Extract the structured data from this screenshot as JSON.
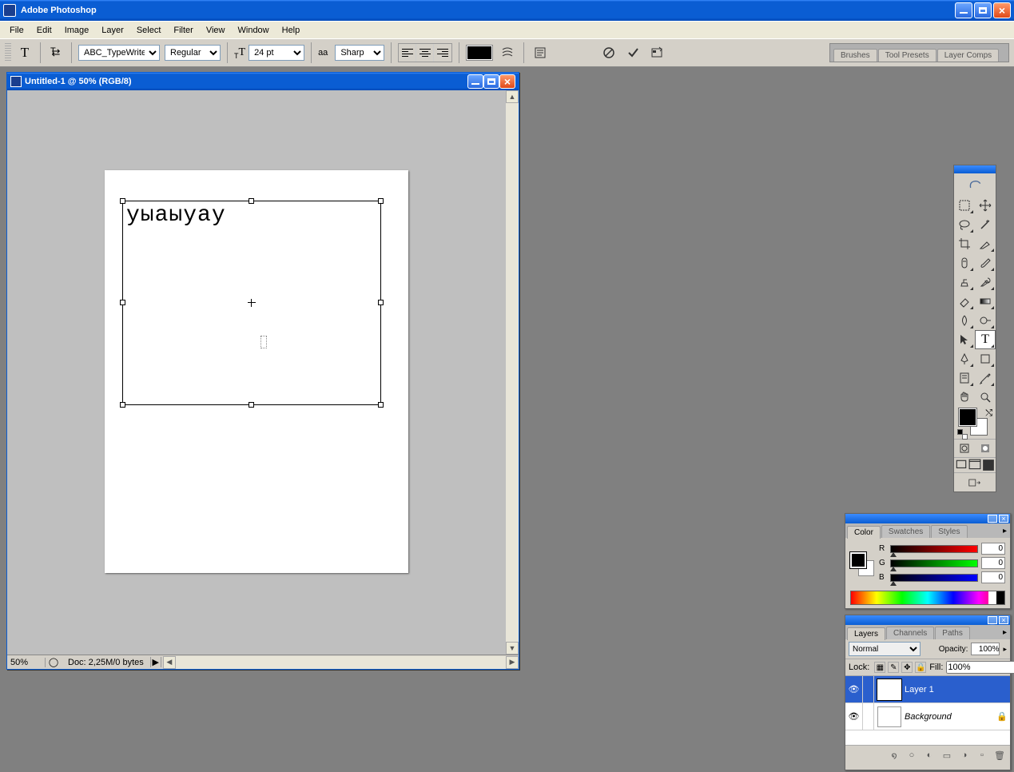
{
  "app": {
    "title": "Adobe Photoshop"
  },
  "menu": [
    "File",
    "Edit",
    "Image",
    "Layer",
    "Select",
    "Filter",
    "View",
    "Window",
    "Help"
  ],
  "options": {
    "font_family": "ABC_TypeWriter...",
    "font_style": "Regular",
    "font_size": "24 pt",
    "aa_label": "aa",
    "antialias": "Sharp",
    "text_color": "#000000",
    "palette_tabs": [
      "Brushes",
      "Tool Presets",
      "Layer Comps"
    ]
  },
  "document": {
    "title": "Untitled-1 @ 50% (RGB/8)",
    "zoom": "50%",
    "doc_info": "Doc: 2,25M/0 bytes",
    "text_content": "уыаыуау"
  },
  "color_panel": {
    "tabs": [
      "Color",
      "Swatches",
      "Styles"
    ],
    "r_label": "R",
    "g_label": "G",
    "b_label": "B",
    "r": "0",
    "g": "0",
    "b": "0"
  },
  "layers_panel": {
    "tabs": [
      "Layers",
      "Channels",
      "Paths"
    ],
    "blend_mode": "Normal",
    "opacity_label": "Opacity:",
    "opacity": "100%",
    "lock_label": "Lock:",
    "fill_label": "Fill:",
    "fill": "100%",
    "layers": [
      {
        "name": "Layer 1",
        "type": "T",
        "selected": true,
        "locked": false
      },
      {
        "name": "Background",
        "type": "",
        "selected": false,
        "locked": true
      }
    ]
  }
}
